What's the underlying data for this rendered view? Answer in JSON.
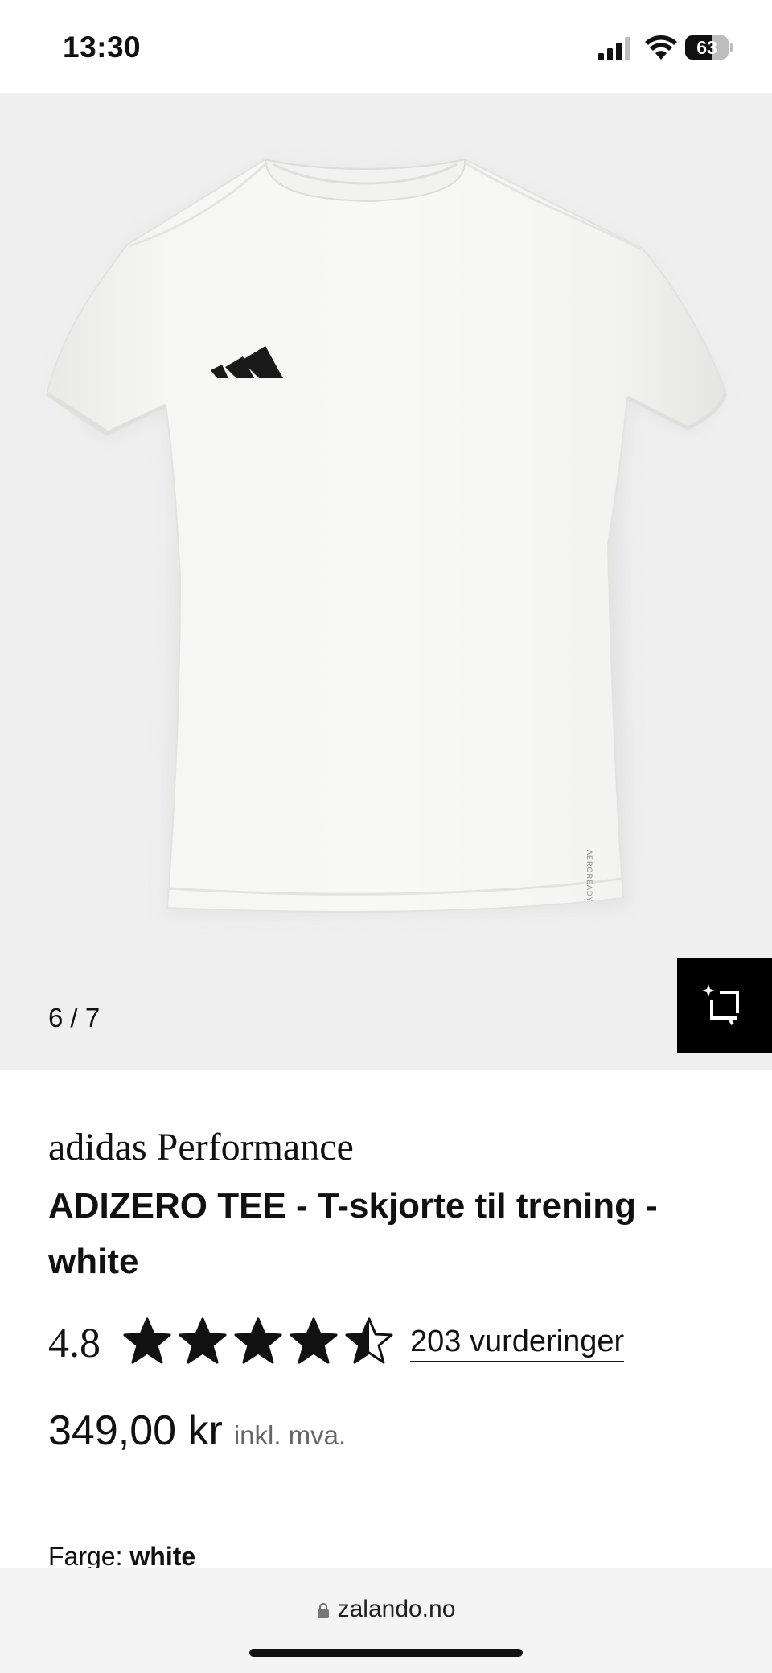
{
  "status_bar": {
    "time": "13:30",
    "battery": "63",
    "battery_level": 0.63
  },
  "gallery": {
    "counter": "6 / 7",
    "image_alt": "white t-shirt with adidas logo"
  },
  "product": {
    "brand": "adidas Performance",
    "title": "ADIZERO TEE - T-skjorte til trening - white",
    "rating": "4.8",
    "stars_filled": 4.5,
    "reviews": "203 vurderinger",
    "price": "349,00 kr",
    "price_note": "inkl. mva.",
    "color_label": "Farge:",
    "color_value": "white"
  },
  "browser": {
    "url": "zalando.no"
  },
  "icons": {
    "ai_button": "sparkle-crop-icon",
    "lock": "lock-icon"
  }
}
